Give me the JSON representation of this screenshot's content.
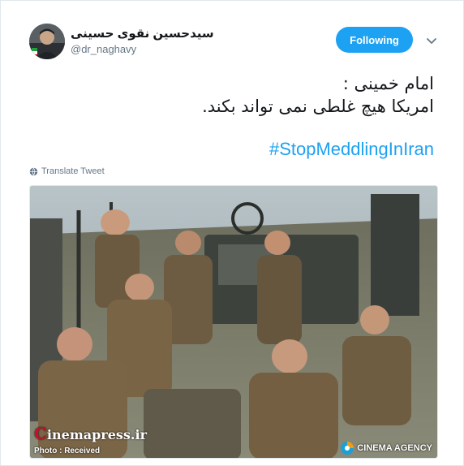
{
  "tweet": {
    "display_name": "سیدحسین نقوی حسینی",
    "username": "@dr_naghavy",
    "follow_label": "Following",
    "text_lines": [
      "امام خمینی :",
      "امریکا هیچ غلطی نمی تواند بکند."
    ],
    "hashtag": "#StopMeddlingInIran",
    "translate_label": "Translate Tweet"
  },
  "media": {
    "watermark_left": "Cinemapress.ir",
    "watermark_left_initial": "C",
    "watermark_left_rest": "inemapress.ir",
    "caption": "Photo : Received",
    "watermark_right": "CINEMA AGENCY"
  },
  "colors": {
    "accent": "#1da1f2",
    "text": "#14171a",
    "muted": "#657786",
    "border": "#e1e8ed"
  },
  "icons": {
    "caret": "chevron-down-icon",
    "translate": "globe-icon",
    "agency_logo": "cinema-agency-logo-icon"
  }
}
